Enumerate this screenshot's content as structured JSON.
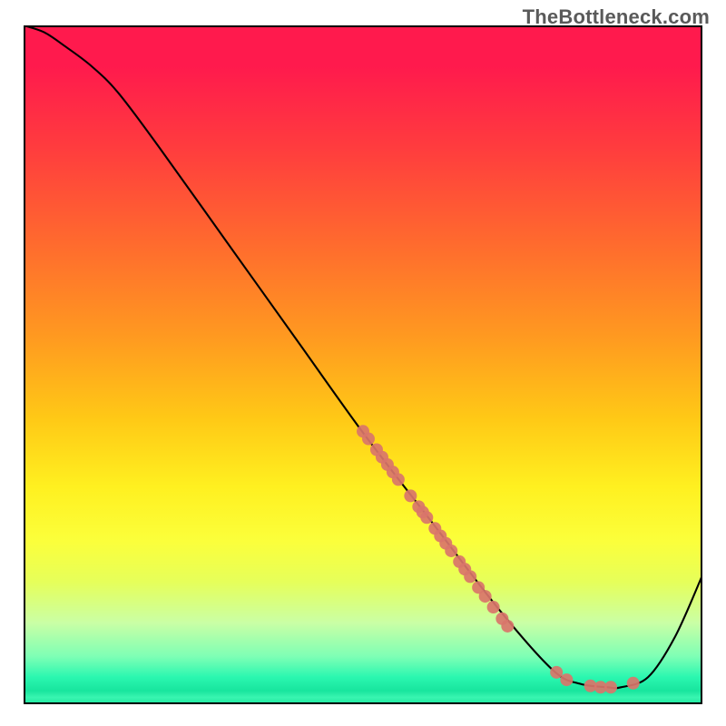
{
  "watermark": "TheBottleneck.com",
  "chart_data": {
    "type": "line",
    "title": "",
    "xlabel": "",
    "ylabel": "",
    "xlim": [
      0,
      100
    ],
    "ylim": [
      0,
      100
    ],
    "grid": false,
    "legend": false,
    "series": [
      {
        "name": "bottleneck-curve",
        "type": "line",
        "color": "#000000",
        "x": [
          0,
          3,
          6,
          10,
          14,
          20,
          30,
          40,
          50,
          60,
          70,
          78,
          82,
          86,
          88,
          92,
          96,
          100
        ],
        "y": [
          100,
          99,
          97,
          94,
          90,
          82,
          68,
          54,
          40,
          27,
          14,
          5,
          3,
          2.5,
          2.5,
          4,
          10,
          19
        ]
      },
      {
        "name": "data-points",
        "type": "scatter",
        "color": "#d9756a",
        "radius": 7,
        "points": [
          {
            "x": 50.0,
            "y": 40.2
          },
          {
            "x": 50.8,
            "y": 39.1
          },
          {
            "x": 52.0,
            "y": 37.5
          },
          {
            "x": 52.8,
            "y": 36.4
          },
          {
            "x": 53.6,
            "y": 35.3
          },
          {
            "x": 54.4,
            "y": 34.2
          },
          {
            "x": 55.2,
            "y": 33.1
          },
          {
            "x": 57.0,
            "y": 30.7
          },
          {
            "x": 58.2,
            "y": 29.1
          },
          {
            "x": 58.8,
            "y": 28.3
          },
          {
            "x": 59.4,
            "y": 27.5
          },
          {
            "x": 60.6,
            "y": 25.9
          },
          {
            "x": 61.4,
            "y": 24.8
          },
          {
            "x": 62.2,
            "y": 23.7
          },
          {
            "x": 63.0,
            "y": 22.6
          },
          {
            "x": 64.2,
            "y": 21.0
          },
          {
            "x": 65.0,
            "y": 19.9
          },
          {
            "x": 65.8,
            "y": 18.8
          },
          {
            "x": 67.0,
            "y": 17.2
          },
          {
            "x": 68.0,
            "y": 15.9
          },
          {
            "x": 69.2,
            "y": 14.3
          },
          {
            "x": 70.5,
            "y": 12.6
          },
          {
            "x": 71.3,
            "y": 11.5
          },
          {
            "x": 78.5,
            "y": 4.7
          },
          {
            "x": 80.0,
            "y": 3.6
          },
          {
            "x": 83.5,
            "y": 2.7
          },
          {
            "x": 85.0,
            "y": 2.5
          },
          {
            "x": 86.5,
            "y": 2.5
          },
          {
            "x": 89.8,
            "y": 3.1
          }
        ]
      }
    ]
  }
}
